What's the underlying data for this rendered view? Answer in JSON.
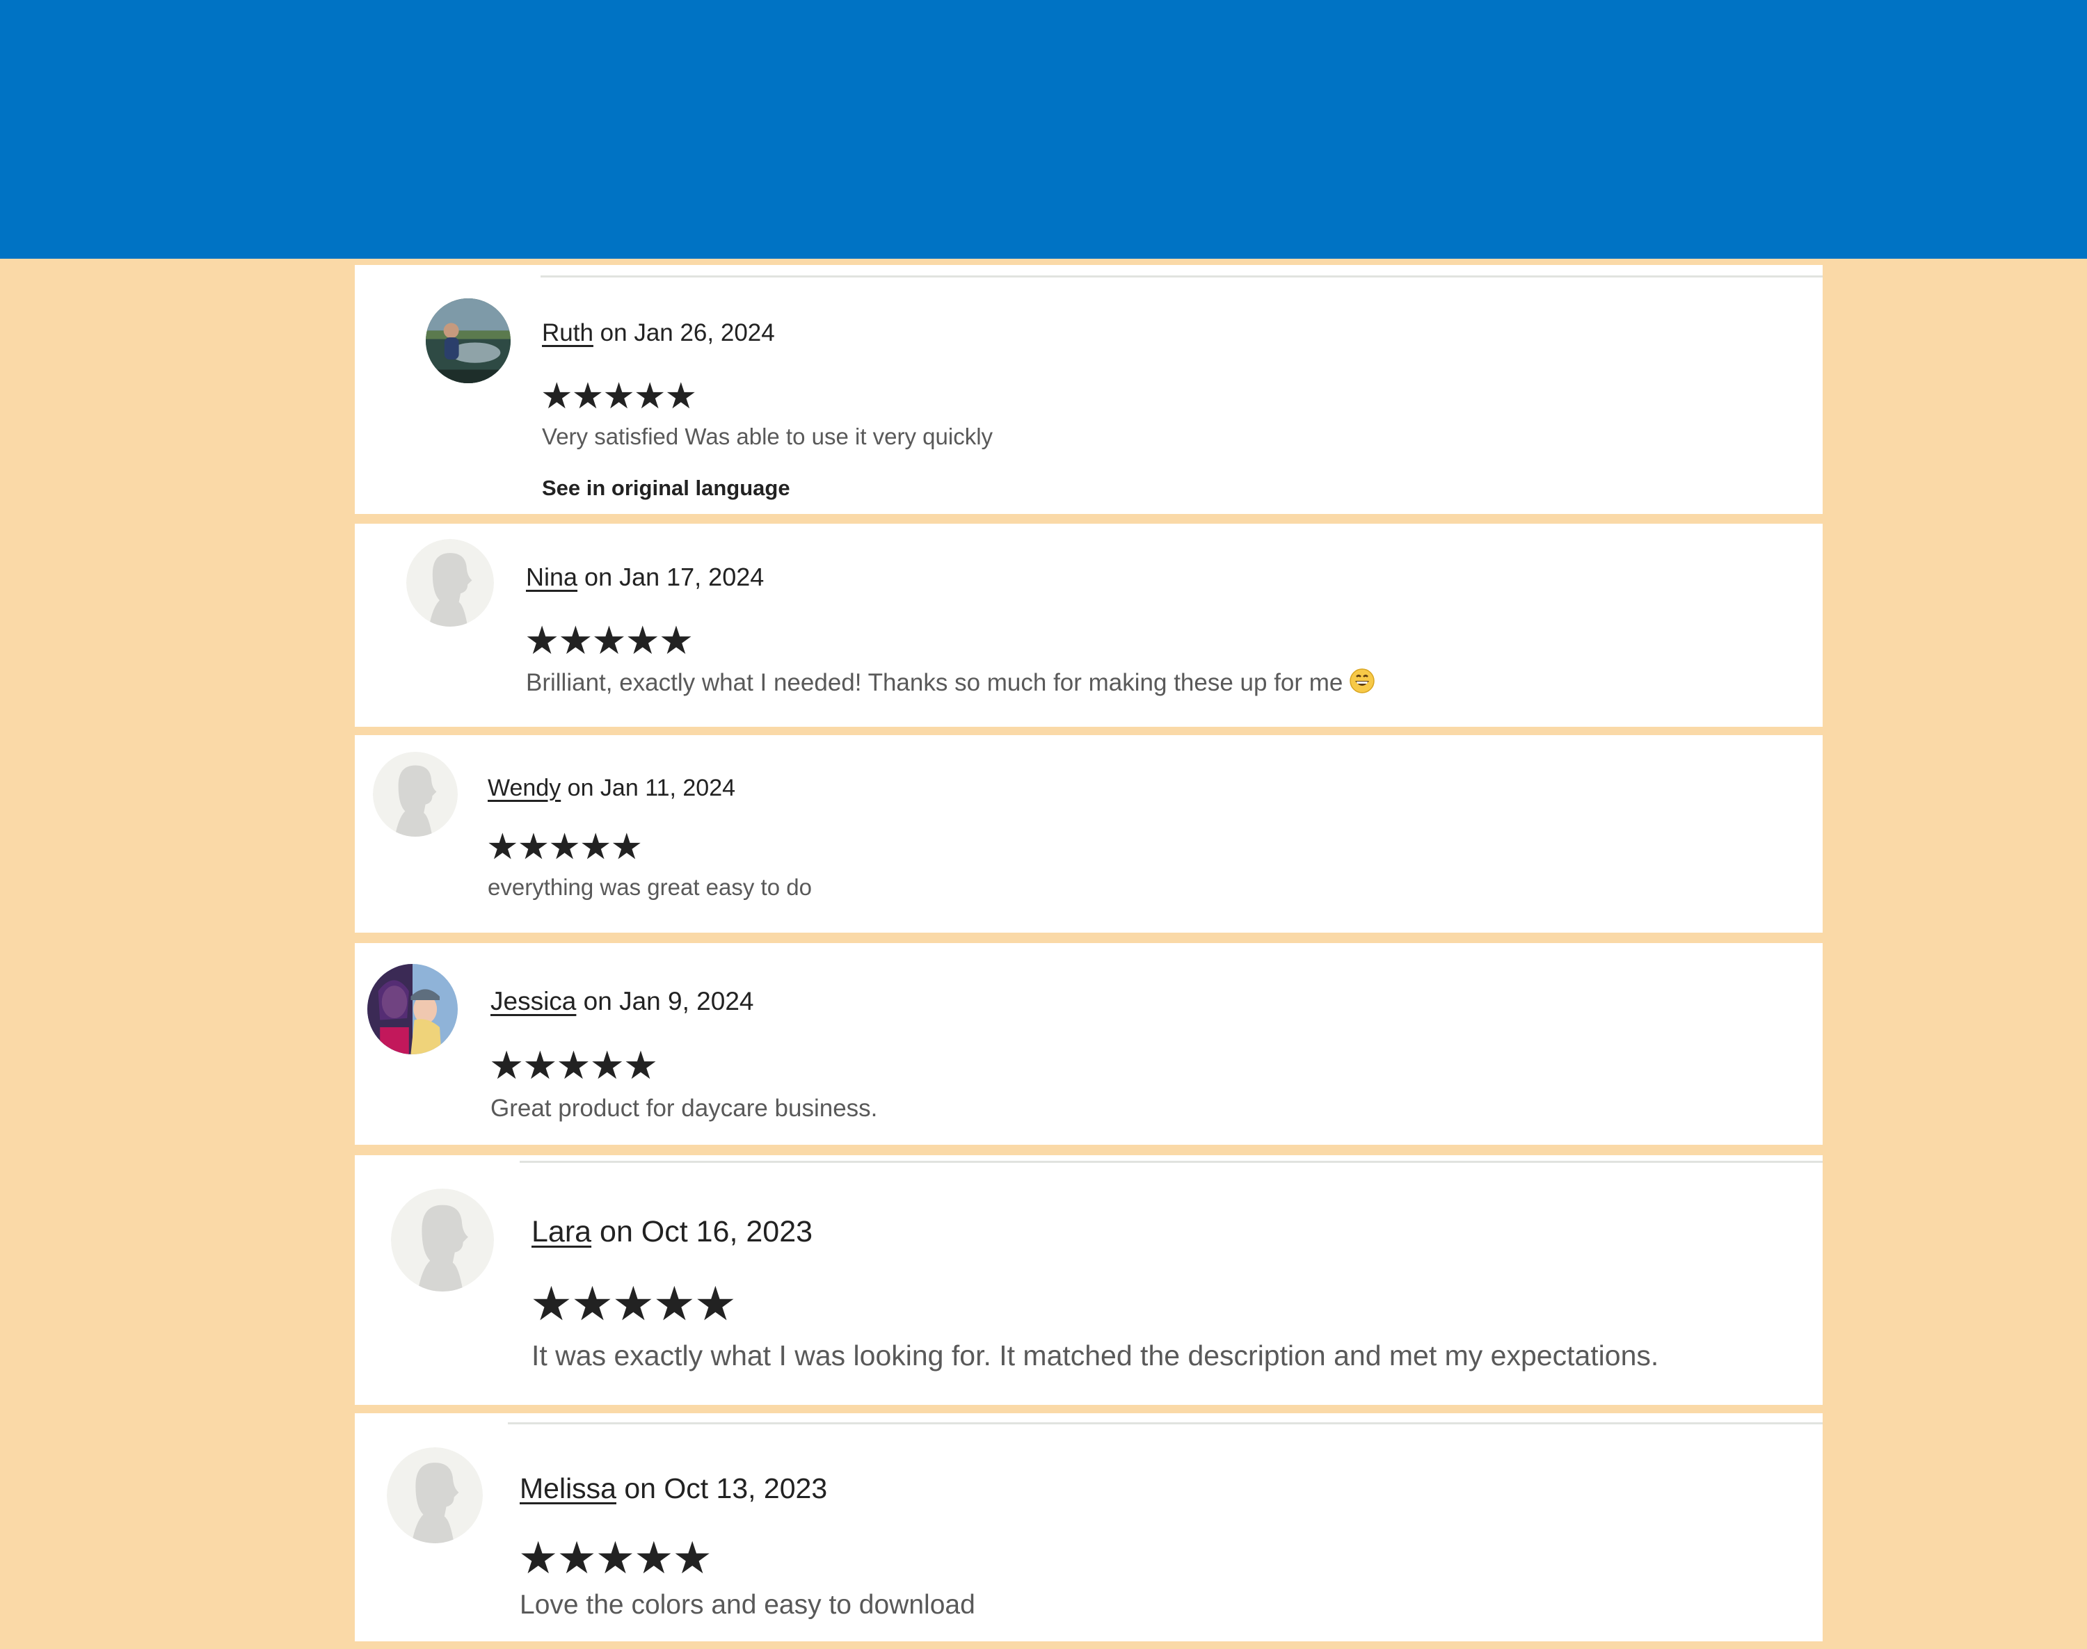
{
  "colors": {
    "banner": "#0073C4",
    "background": "#FAD9A7",
    "card": "#FFFFFF",
    "star": "#222222",
    "body_text": "#595959"
  },
  "reviews": [
    {
      "reviewer": "Ruth",
      "date_text": " on Jan 26, 2024",
      "rating": 5,
      "stars": "★★★★★",
      "text": "Very satisfied Was able to use it very quickly",
      "translate_link": "See in original language",
      "avatar": "photo-avatar"
    },
    {
      "reviewer": "Nina",
      "date_text": " on Jan 17, 2024",
      "rating": 5,
      "stars": "★★★★★",
      "text": "Brilliant, exactly what I needed! Thanks so much for making these up for me",
      "emoji": "grinning-face-emoji",
      "avatar": "default-avatar"
    },
    {
      "reviewer": "Wendy",
      "date_text": " on Jan 11, 2024",
      "rating": 5,
      "stars": "★★★★★",
      "text": "everything was great easy to do",
      "avatar": "default-avatar"
    },
    {
      "reviewer": "Jessica",
      "date_text": " on Jan 9, 2024",
      "rating": 5,
      "stars": "★★★★★",
      "text": "Great product for daycare business.",
      "avatar": "photo-avatar"
    },
    {
      "reviewer": "Lara",
      "date_text": " on Oct 16, 2023",
      "rating": 5,
      "stars": "★★★★★",
      "text": "It was exactly what I was looking for. It matched the description and met my expectations.",
      "avatar": "default-avatar"
    },
    {
      "reviewer": "Melissa",
      "date_text": " on Oct 13, 2023",
      "rating": 5,
      "stars": "★★★★★",
      "text": "Love the colors and easy to download",
      "avatar": "default-avatar"
    }
  ]
}
